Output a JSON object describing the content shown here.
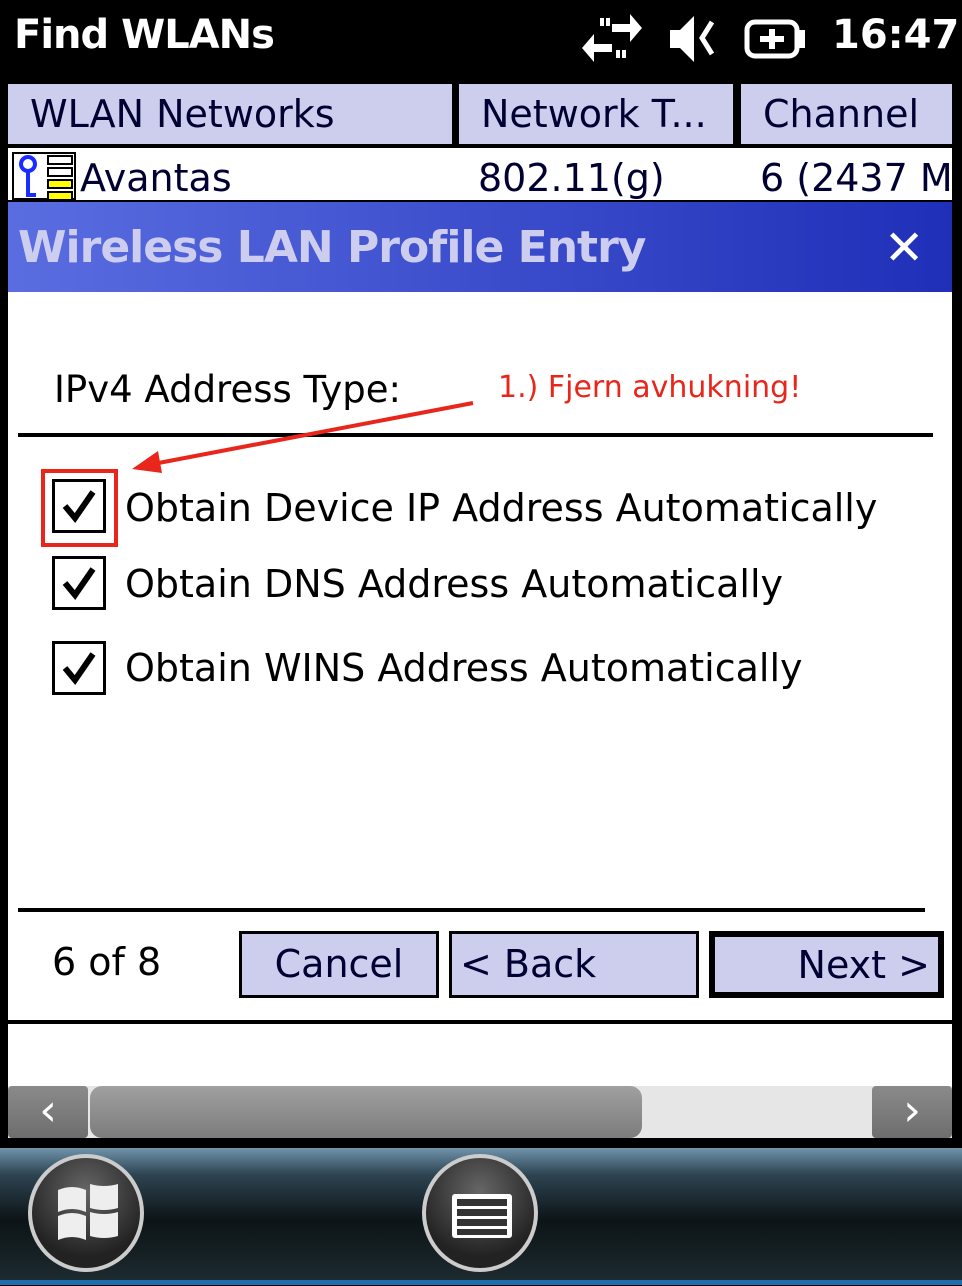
{
  "statusbar": {
    "title": "Find WLANs",
    "time": "16:47",
    "icons": [
      "connectivity-arrows-icon",
      "speaker-muted-icon",
      "battery-charging-icon"
    ]
  },
  "table": {
    "columns": [
      "WLAN Networks",
      "Network T...",
      "Channel"
    ],
    "rows": [
      {
        "name": "Avantas",
        "type": "802.11(g)",
        "channel": "6 (2437 M"
      }
    ]
  },
  "dialog": {
    "title": "Wireless LAN Profile Entry",
    "section_label": "IPv4 Address Type:",
    "options": [
      {
        "label": "Obtain Device IP Address Automatically",
        "checked": true
      },
      {
        "label": "Obtain DNS Address Automatically",
        "checked": true
      },
      {
        "label": "Obtain WINS Address Automatically",
        "checked": true
      }
    ],
    "page": "6 of 8",
    "buttons": {
      "cancel": "Cancel",
      "back": "< Back",
      "next": "Next >"
    }
  },
  "annotation": {
    "text": "1.) Fjern avhukning!",
    "color": "#e8261c"
  },
  "colors": {
    "header_bg": "#cdcdee",
    "title_gradient_start": "#5a6de0",
    "title_gradient_end": "#1f2fb8"
  }
}
